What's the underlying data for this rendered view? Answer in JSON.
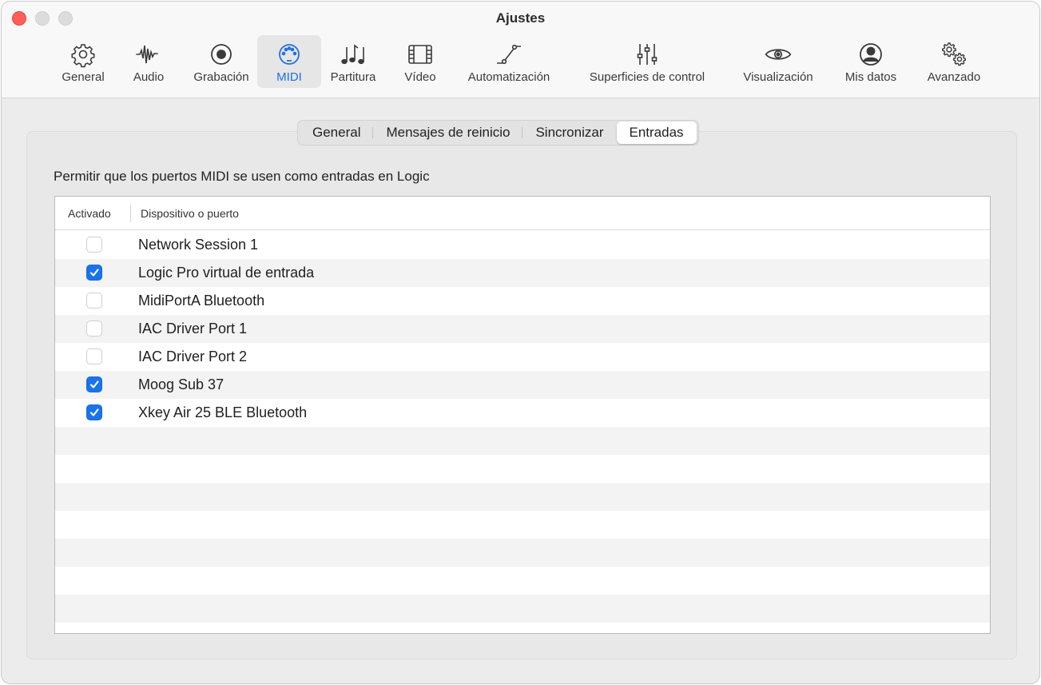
{
  "window": {
    "title": "Ajustes"
  },
  "toolbar": [
    {
      "id": "general",
      "label": "General",
      "icon": "gear-icon",
      "selected": false
    },
    {
      "id": "audio",
      "label": "Audio",
      "icon": "waveform-icon",
      "selected": false
    },
    {
      "id": "grabacion",
      "label": "Grabación",
      "icon": "record-icon",
      "selected": false
    },
    {
      "id": "midi",
      "label": "MIDI",
      "icon": "midi-connector-icon",
      "selected": true
    },
    {
      "id": "partitura",
      "label": "Partitura",
      "icon": "music-notes-icon",
      "selected": false
    },
    {
      "id": "video",
      "label": "Vídeo",
      "icon": "film-icon",
      "selected": false
    },
    {
      "id": "automatizacion",
      "label": "Automatización",
      "icon": "automation-curve-icon",
      "selected": false
    },
    {
      "id": "superficies",
      "label": "Superficies de control",
      "icon": "sliders-icon",
      "selected": false
    },
    {
      "id": "visualizacion",
      "label": "Visualización",
      "icon": "eye-icon",
      "selected": false
    },
    {
      "id": "misdatos",
      "label": "Mis datos",
      "icon": "user-circle-icon",
      "selected": false
    },
    {
      "id": "avanzado",
      "label": "Avanzado",
      "icon": "gears-icon",
      "selected": false
    }
  ],
  "tabs": [
    {
      "label": "General",
      "active": false
    },
    {
      "label": "Mensajes de reinicio",
      "active": false
    },
    {
      "label": "Sincronizar",
      "active": false
    },
    {
      "label": "Entradas",
      "active": true
    }
  ],
  "description": "Permitir que los puertos MIDI se usen como entradas en Logic",
  "table": {
    "columns": [
      "Activado",
      "Dispositivo o puerto"
    ],
    "rows": [
      {
        "enabled": false,
        "name": "Network Session 1"
      },
      {
        "enabled": true,
        "name": "Logic Pro virtual de entrada"
      },
      {
        "enabled": false,
        "name": "MidiPortA Bluetooth"
      },
      {
        "enabled": false,
        "name": "IAC Driver Port 1"
      },
      {
        "enabled": false,
        "name": "IAC Driver Port 2"
      },
      {
        "enabled": true,
        "name": "Moog Sub 37"
      },
      {
        "enabled": true,
        "name": "Xkey Air 25 BLE Bluetooth"
      }
    ]
  },
  "colors": {
    "accent": "#1f6fe5",
    "checkbox_on": "#1a73e8",
    "close": "#ff5f57"
  }
}
